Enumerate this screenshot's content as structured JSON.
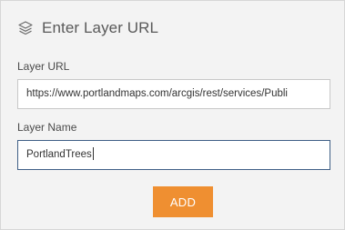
{
  "header": {
    "icon": "layers-icon",
    "title": "Enter Layer URL"
  },
  "form": {
    "url_label": "Layer URL",
    "url_value": "https://www.portlandmaps.com/arcgis/rest/services/Publi",
    "name_label": "Layer Name",
    "name_value": "PortlandTrees",
    "add_label": "ADD"
  },
  "colors": {
    "panel_bg": "#f3f3f3",
    "accent_button": "#ef8f31",
    "focus_border": "#3f5f86"
  }
}
